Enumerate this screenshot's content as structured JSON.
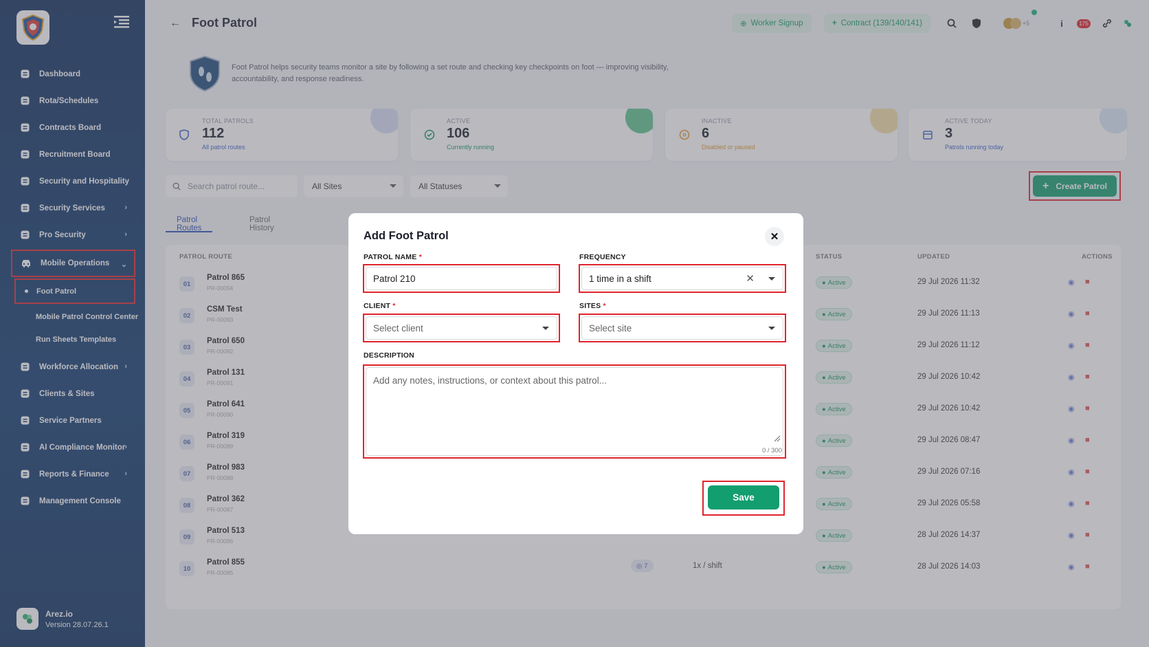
{
  "sidebar": {
    "nav": [
      {
        "label": "Dashboard",
        "icon": "dashboard-icon",
        "chevron": ""
      },
      {
        "label": "Rota/Schedules",
        "icon": "calendar-icon",
        "chevron": ""
      },
      {
        "label": "Contracts Board",
        "icon": "contracts-icon",
        "chevron": ""
      },
      {
        "label": "Recruitment Board",
        "icon": "clipboard-icon",
        "chevron": ""
      },
      {
        "label": "Security and Hospitality",
        "icon": "user-icon",
        "chevron": "›"
      },
      {
        "label": "Security Services",
        "icon": "user-icon",
        "chevron": "›"
      },
      {
        "label": "Pro Security",
        "icon": "user-icon",
        "chevron": "›"
      }
    ],
    "open_item": {
      "label": "Mobile Operations",
      "icon": "car-icon",
      "chevron": "⌄"
    },
    "sub_items": [
      "Foot Patrol",
      "Mobile Patrol Control Center",
      "Run Sheets Templates"
    ],
    "nav_after": [
      {
        "label": "Workforce Allocation",
        "icon": "list-icon",
        "chevron": "›"
      },
      {
        "label": "Clients & Sites",
        "icon": "handshake-icon",
        "chevron": ""
      },
      {
        "label": "Service Partners",
        "icon": "partners-icon",
        "chevron": ""
      },
      {
        "label": "AI Compliance Monitor",
        "icon": "robot-icon",
        "chevron": "›"
      },
      {
        "label": "Reports & Finance",
        "icon": "chart-icon",
        "chevron": "›"
      },
      {
        "label": "Management Console",
        "icon": "gears-icon",
        "chevron": ""
      }
    ],
    "footer": {
      "name": "Arez.io",
      "version": "Version 28.07.26.1"
    }
  },
  "header": {
    "title": "Foot Patrol",
    "worker_signup": "Worker Signup",
    "contract": "Contract (139/140/141)",
    "avatar_extra": "+5",
    "notif_count": "175"
  },
  "intro": "Foot Patrol helps security teams monitor a site by following a set route and checking key checkpoints on foot — improving visibility, accountability, and response readiness.",
  "cards": [
    {
      "label": "TOTAL PATROLS",
      "value": "112",
      "sub": "All patrol routes"
    },
    {
      "label": "ACTIVE",
      "value": "106",
      "sub": "Currently running"
    },
    {
      "label": "INACTIVE",
      "value": "6",
      "sub": "Disabled or paused"
    },
    {
      "label": "ACTIVE TODAY",
      "value": "3",
      "sub": "Patrols running today"
    }
  ],
  "filters": {
    "search_placeholder": "Search patrol route...",
    "sites": "All Sites",
    "statuses": "All Statuses",
    "create": "Create Patrol"
  },
  "tabs": [
    "Patrol Routes",
    "Patrol History"
  ],
  "table": {
    "headers": {
      "route": "PATROL ROUTE",
      "status": "STATUS",
      "updated": "UPDATED",
      "actions": "ACTIONS"
    },
    "rows": [
      {
        "num": "01",
        "name": "Patrol 865",
        "id": "PR-00094",
        "status": "Active",
        "updated": "29 Jul 2026 11:32"
      },
      {
        "num": "02",
        "name": "CSM Test",
        "id": "PR-00093",
        "status": "Active",
        "updated": "29 Jul 2026 11:13"
      },
      {
        "num": "03",
        "name": "Patrol 650",
        "id": "PR-00092",
        "status": "Active",
        "updated": "29 Jul 2026 11:12"
      },
      {
        "num": "04",
        "name": "Patrol 131",
        "id": "PR-00091",
        "status": "Active",
        "updated": "29 Jul 2026 10:42"
      },
      {
        "num": "05",
        "name": "Patrol 641",
        "id": "PR-00090",
        "status": "Active",
        "updated": "29 Jul 2026 10:42"
      },
      {
        "num": "06",
        "name": "Patrol 319",
        "id": "PR-00089",
        "status": "Active",
        "updated": "29 Jul 2026 08:47"
      },
      {
        "num": "07",
        "name": "Patrol 983",
        "id": "PR-00088",
        "status": "Active",
        "updated": "29 Jul 2026 07:16"
      },
      {
        "num": "08",
        "name": "Patrol 362",
        "id": "PR-00087",
        "status": "Active",
        "updated": "29 Jul 2026 05:58"
      },
      {
        "num": "09",
        "name": "Patrol 513",
        "id": "PR-00086",
        "status": "Active",
        "updated": "28 Jul 2026 14:37"
      },
      {
        "num": "10",
        "name": "Patrol 855",
        "id": "PR-00085",
        "status": "Active",
        "updated": "28 Jul 2026 14:03",
        "checkpoints": "7",
        "frequency": "1x / shift"
      }
    ]
  },
  "modal": {
    "title": "Add Foot Patrol",
    "patrol_name_label": "PATROL NAME",
    "patrol_name_value": "Patrol 210",
    "frequency_label": "FREQUENCY",
    "frequency_value": "1 time in a shift",
    "client_label": "CLIENT",
    "client_placeholder": "Select client",
    "sites_label": "SITES",
    "sites_placeholder": "Select site",
    "description_label": "DESCRIPTION",
    "description_placeholder": "Add any notes, instructions, or context about this patrol...",
    "char_count": "0 / 300",
    "save": "Save",
    "required_mark": "*"
  },
  "colors": {
    "primary": "#129e6e",
    "sidebar": "#0f3a6e",
    "highlight": "#e0242c",
    "accent": "#2751b5"
  }
}
